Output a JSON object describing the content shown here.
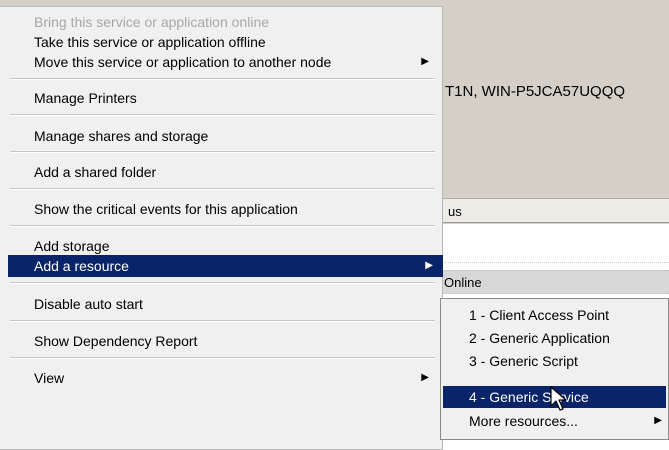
{
  "background": {
    "nodes_text": "T1N, WIN-P5JCA57UQQQ",
    "status_header": "us",
    "row_status": "Online"
  },
  "context_menu": {
    "items": [
      {
        "label": "Bring this service or application online",
        "disabled": true
      },
      {
        "label": "Take this service or application offline"
      },
      {
        "label": "Move this service or application to another node",
        "submenu_arrow": "▶"
      },
      {
        "label": "Manage Printers"
      },
      {
        "label": "Manage shares and storage"
      },
      {
        "label": "Add a shared folder"
      },
      {
        "label": "Show the critical events for this application"
      },
      {
        "label": "Add storage"
      },
      {
        "label": "Add a resource",
        "submenu_arrow": "▶",
        "selected": true
      },
      {
        "label": "Disable auto start"
      },
      {
        "label": "Show Dependency Report"
      },
      {
        "label": "View",
        "submenu_arrow": "▶"
      }
    ]
  },
  "submenu": {
    "items": [
      {
        "label": "1 - Client Access Point"
      },
      {
        "label": "2 - Generic Application"
      },
      {
        "label": "3 - Generic Script"
      },
      {
        "label": "4 - Generic Service",
        "selected": true
      },
      {
        "label": "More resources...",
        "submenu_arrow": "▶"
      }
    ]
  },
  "colors": {
    "highlight": "#0a246a",
    "menu_bg": "#f0f0f0",
    "disabled_text": "#a8a8a8"
  },
  "icons": [
    "submenu-arrow-icon",
    "mouse-pointer-icon"
  ]
}
